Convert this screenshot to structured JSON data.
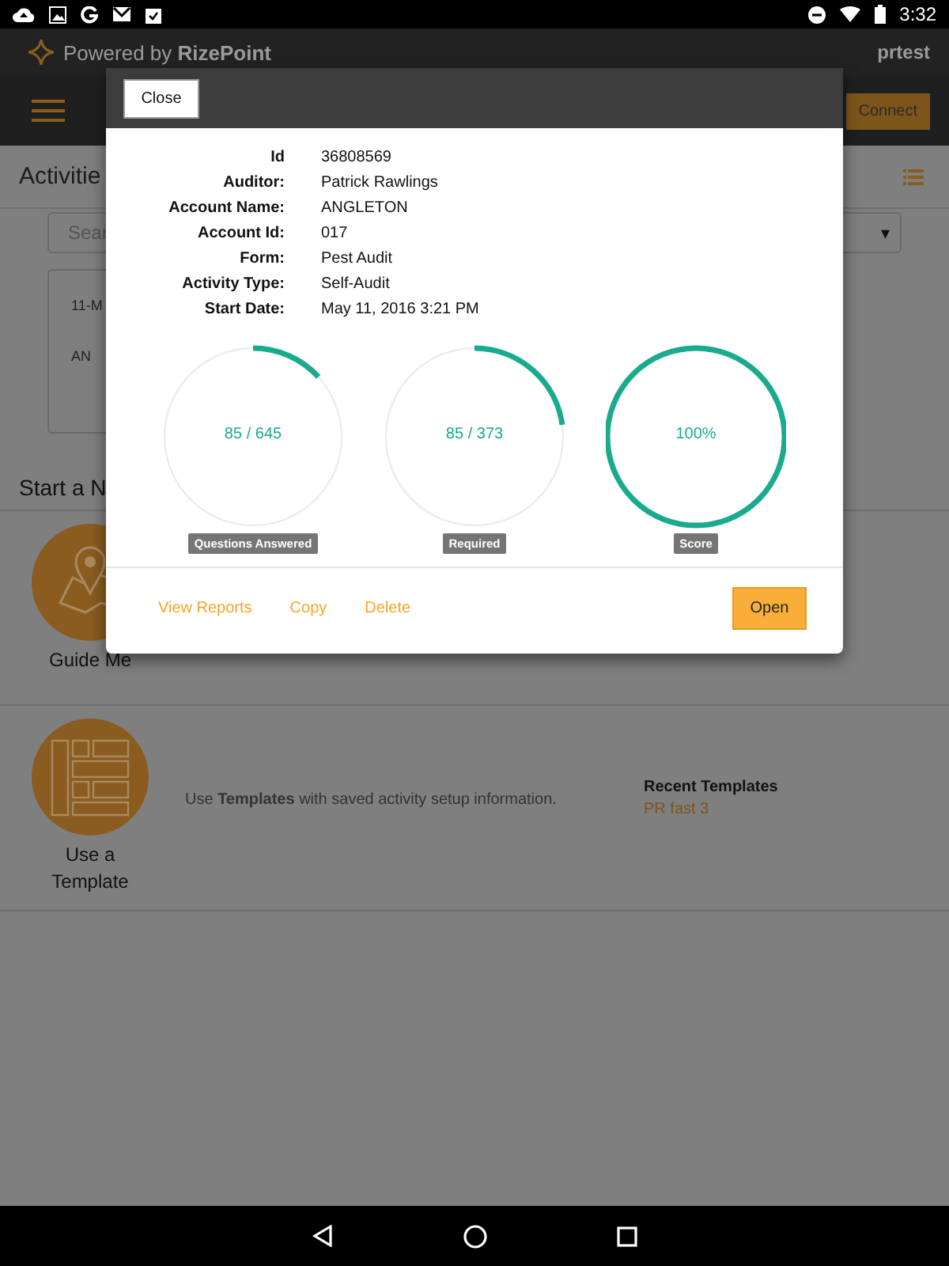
{
  "status_bar": {
    "time": "3:32"
  },
  "header": {
    "brand_prefix": "Powered by",
    "brand_name": "RizePoint",
    "user": "prtest"
  },
  "toolbar": {
    "connect": "Connect"
  },
  "activities": {
    "title": "Activitie",
    "search_placeholder": "Sear",
    "dropdown_arrow": "▾",
    "card": {
      "date": "11-M",
      "account": "AN"
    }
  },
  "start_new": {
    "title": "Start a N",
    "options": [
      {
        "kind": "guide",
        "label": "Guide Me"
      },
      {
        "kind": "template",
        "label": "Use a Template",
        "description": "Use **Templates** with saved activity setup information.",
        "recent_title": "Recent Templates",
        "recent": [
          "PR fast 3"
        ]
      }
    ]
  },
  "dialog": {
    "close": "Close",
    "details": [
      {
        "label": "Id",
        "value": "36808569"
      },
      {
        "label": "Auditor:",
        "value": "Patrick Rawlings"
      },
      {
        "label": "Account Name:",
        "value": "ANGLETON"
      },
      {
        "label": "Account Id:",
        "value": "017"
      },
      {
        "label": "Form:",
        "value": "Pest Audit"
      },
      {
        "label": "Activity Type:",
        "value": "Self-Audit"
      },
      {
        "label": "Start Date:",
        "value": "May 11, 2016 3:21 PM"
      }
    ],
    "gauges": [
      {
        "reading": "85 / 645",
        "label": "Questions Answered",
        "level": 0.132
      },
      {
        "reading": "85 / 373",
        "label": "Required",
        "level": 0.228
      },
      {
        "reading": "100%",
        "label": "Score",
        "level": 1
      }
    ],
    "actions": [
      "View Reports",
      "Copy",
      "Delete"
    ],
    "primary": "Open"
  }
}
